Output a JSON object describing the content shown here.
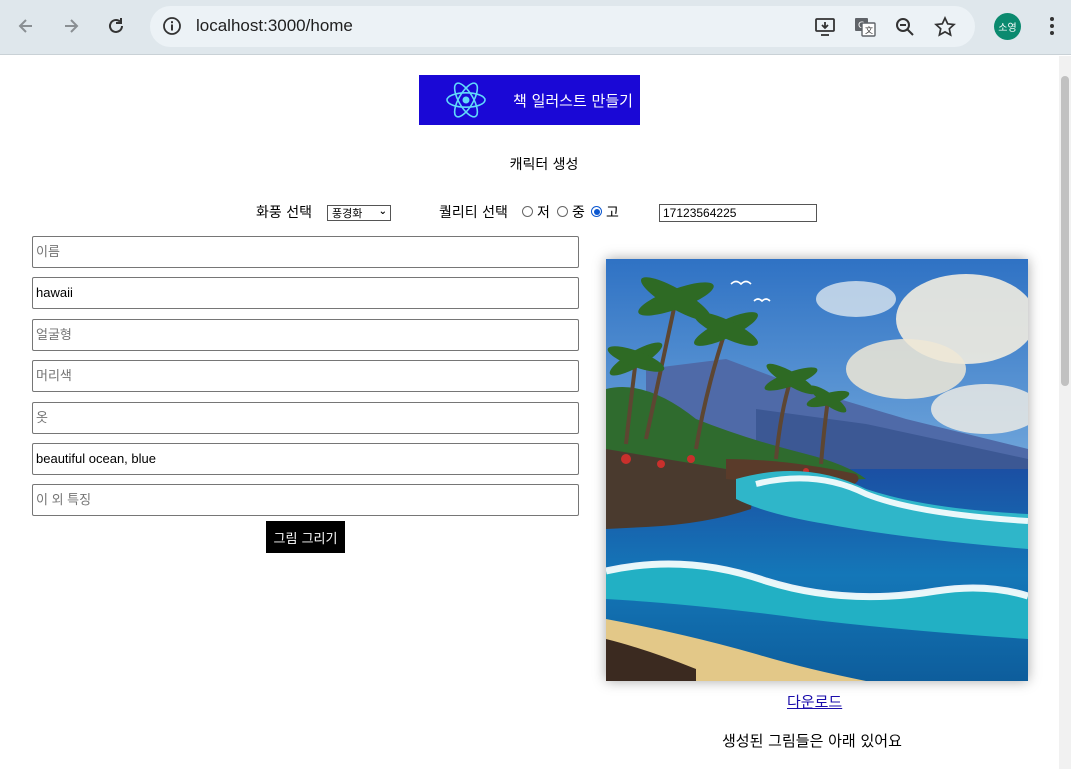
{
  "browser": {
    "url": "localhost:3000/home",
    "profile_initials": "소영"
  },
  "header": {
    "logo_text": "책 일러스트 만들기",
    "brand_color": "#1a08d6"
  },
  "section": {
    "title": "캐릭터 생성"
  },
  "options": {
    "style_label": "화풍 선택",
    "style_selected": "풍경화",
    "quality_label": "퀄리티 선택",
    "quality_options": [
      "저",
      "중",
      "고"
    ],
    "quality_selected": "고",
    "seed_value": "17123564225"
  },
  "form": {
    "fields": [
      {
        "placeholder": "이름",
        "value": ""
      },
      {
        "placeholder": "",
        "value": "hawaii"
      },
      {
        "placeholder": "얼굴형",
        "value": ""
      },
      {
        "placeholder": "머리색",
        "value": ""
      },
      {
        "placeholder": "옷",
        "value": ""
      },
      {
        "placeholder": "",
        "value": "beautiful ocean, blue"
      },
      {
        "placeholder": "이 외 특징",
        "value": ""
      }
    ],
    "submit_label": "그림 그리기"
  },
  "result": {
    "download_label": "다운로드",
    "note": "생성된 그림들은 아래 있어요"
  }
}
